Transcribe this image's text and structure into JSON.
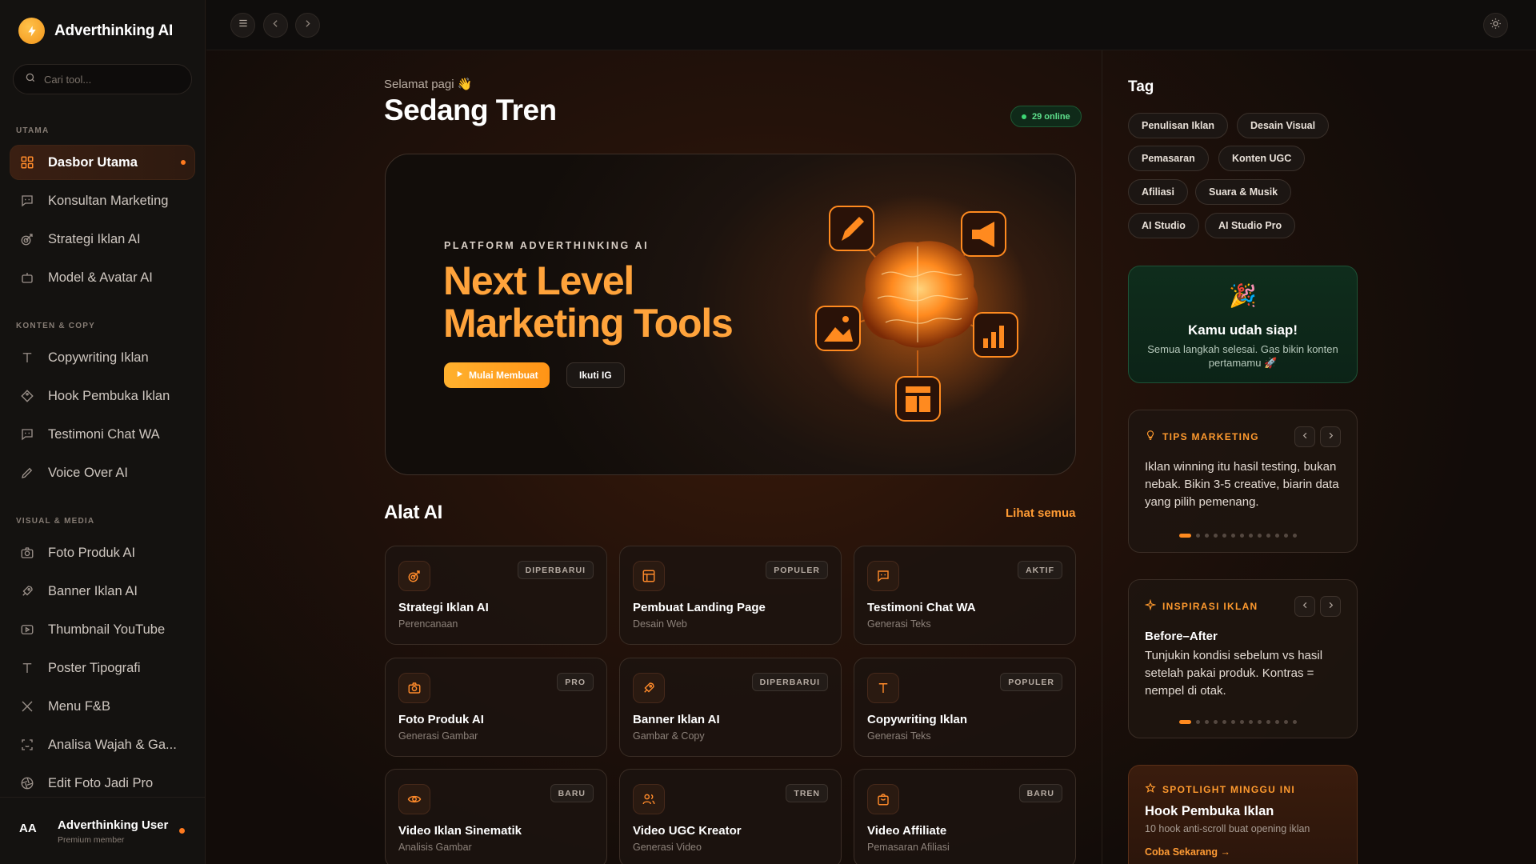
{
  "app": {
    "name": "Adverthinking AI",
    "search_placeholder": "Cari tool..."
  },
  "sidebar": {
    "sections": [
      {
        "label": "UTAMA",
        "items": [
          {
            "label": "Dasbor Utama",
            "icon": "grid-icon",
            "active": true
          },
          {
            "label": "Konsultan Marketing",
            "icon": "chat-icon"
          },
          {
            "label": "Strategi Iklan AI",
            "icon": "target-icon"
          },
          {
            "label": "Model & Avatar AI",
            "icon": "robot-icon"
          }
        ]
      },
      {
        "label": "KONTEN & COPY",
        "items": [
          {
            "label": "Copywriting Iklan",
            "icon": "type-icon"
          },
          {
            "label": "Hook Pembuka Iklan",
            "icon": "tag-icon"
          },
          {
            "label": "Testimoni Chat WA",
            "icon": "chat-icon"
          },
          {
            "label": "Voice Over AI",
            "icon": "pen-icon"
          }
        ]
      },
      {
        "label": "VISUAL & MEDIA",
        "items": [
          {
            "label": "Foto Produk AI",
            "icon": "camera-icon"
          },
          {
            "label": "Banner Iklan AI",
            "icon": "rocket-icon"
          },
          {
            "label": "Thumbnail YouTube",
            "icon": "play-icon"
          },
          {
            "label": "Poster Tipografi",
            "icon": "type-icon"
          },
          {
            "label": "Menu F&B",
            "icon": "utensils-icon"
          },
          {
            "label": "Analisa Wajah & Ga...",
            "icon": "scan-icon"
          },
          {
            "label": "Edit Foto Jadi Pro",
            "icon": "aperture-icon"
          }
        ]
      }
    ],
    "user": {
      "initials": "AA",
      "name": "Adverthinking User",
      "role": "Premium member"
    }
  },
  "header": {
    "greeting": "Selamat pagi 👋",
    "title": "Sedang Tren",
    "online": "29 online"
  },
  "hero": {
    "kicker": "PLATFORM ADVERTHINKING AI",
    "title_line1": "Next Level",
    "title_line2": "Marketing Tools",
    "primary_button": "Mulai Membuat",
    "secondary_button": "Ikuti IG"
  },
  "tools": {
    "title": "Alat AI",
    "see_all": "Lihat semua",
    "items": [
      {
        "name": "Strategi Iklan AI",
        "category": "Perencanaan",
        "badge": "DIPERBARUI",
        "icon": "target-icon"
      },
      {
        "name": "Pembuat Landing Page",
        "category": "Desain Web",
        "badge": "POPULER",
        "icon": "layout-icon"
      },
      {
        "name": "Testimoni Chat WA",
        "category": "Generasi Teks",
        "badge": "AKTIF",
        "icon": "chat-icon"
      },
      {
        "name": "Foto Produk AI",
        "category": "Generasi Gambar",
        "badge": "PRO",
        "icon": "camera-icon"
      },
      {
        "name": "Banner Iklan AI",
        "category": "Gambar & Copy",
        "badge": "DIPERBARUI",
        "icon": "rocket-icon"
      },
      {
        "name": "Copywriting Iklan",
        "category": "Generasi Teks",
        "badge": "POPULER",
        "icon": "type-icon"
      },
      {
        "name": "Video Iklan Sinematik",
        "category": "Analisis Gambar",
        "badge": "BARU",
        "icon": "eye-icon"
      },
      {
        "name": "Video UGC Kreator",
        "category": "Generasi Video",
        "badge": "TREN",
        "icon": "users-icon"
      },
      {
        "name": "Video Affiliate",
        "category": "Pemasaran Afiliasi",
        "badge": "BARU",
        "icon": "bag-icon"
      }
    ]
  },
  "tags": {
    "title": "Tag",
    "items": [
      "Penulisan Iklan",
      "Desain Visual",
      "Pemasaran",
      "Konten UGC",
      "Afiliasi",
      "Suara & Musik",
      "AI Studio",
      "AI Studio Pro"
    ]
  },
  "ready": {
    "emoji": "🎉",
    "title": "Kamu udah siap!",
    "text": "Semua langkah selesai. Gas bikin konten pertamamu 🚀"
  },
  "tips": {
    "label": "TIPS MARKETING",
    "body": "Iklan winning itu hasil testing, bukan nebak. Bikin 3-5 creative, biarin data yang pilih pemenang.",
    "slides": 13,
    "active_slide": 0
  },
  "inspirasi": {
    "label": "INSPIRASI IKLAN",
    "subtitle": "Before–After",
    "body": "Tunjukin kondisi sebelum vs hasil setelah pakai produk. Kontras = nempel di otak.",
    "slides": 13,
    "active_slide": 0
  },
  "spotlight": {
    "label": "SPOTLIGHT MINGGU INI",
    "title": "Hook Pembuka Iklan",
    "text": "10 hook anti-scroll buat opening iklan",
    "link": "Coba Sekarang →"
  },
  "colors": {
    "accent": "#ff9416",
    "success": "#3dd674",
    "background": "#120c09"
  }
}
